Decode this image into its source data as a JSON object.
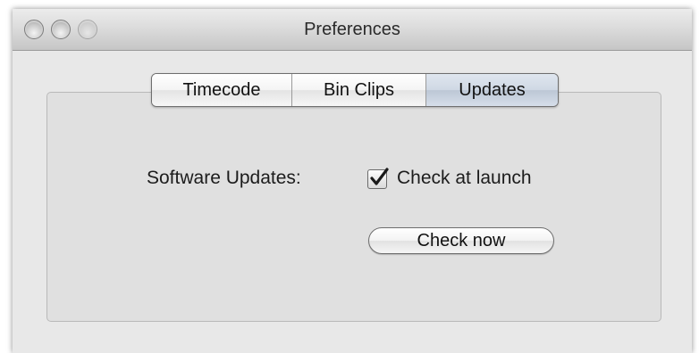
{
  "window": {
    "title": "Preferences"
  },
  "tabs": [
    {
      "label": "Timecode",
      "selected": false
    },
    {
      "label": "Bin Clips",
      "selected": false
    },
    {
      "label": "Updates",
      "selected": true
    }
  ],
  "updates": {
    "section_label": "Software Updates:",
    "check_at_launch_label": "Check at launch",
    "check_at_launch_checked": true,
    "check_now_label": "Check now"
  }
}
